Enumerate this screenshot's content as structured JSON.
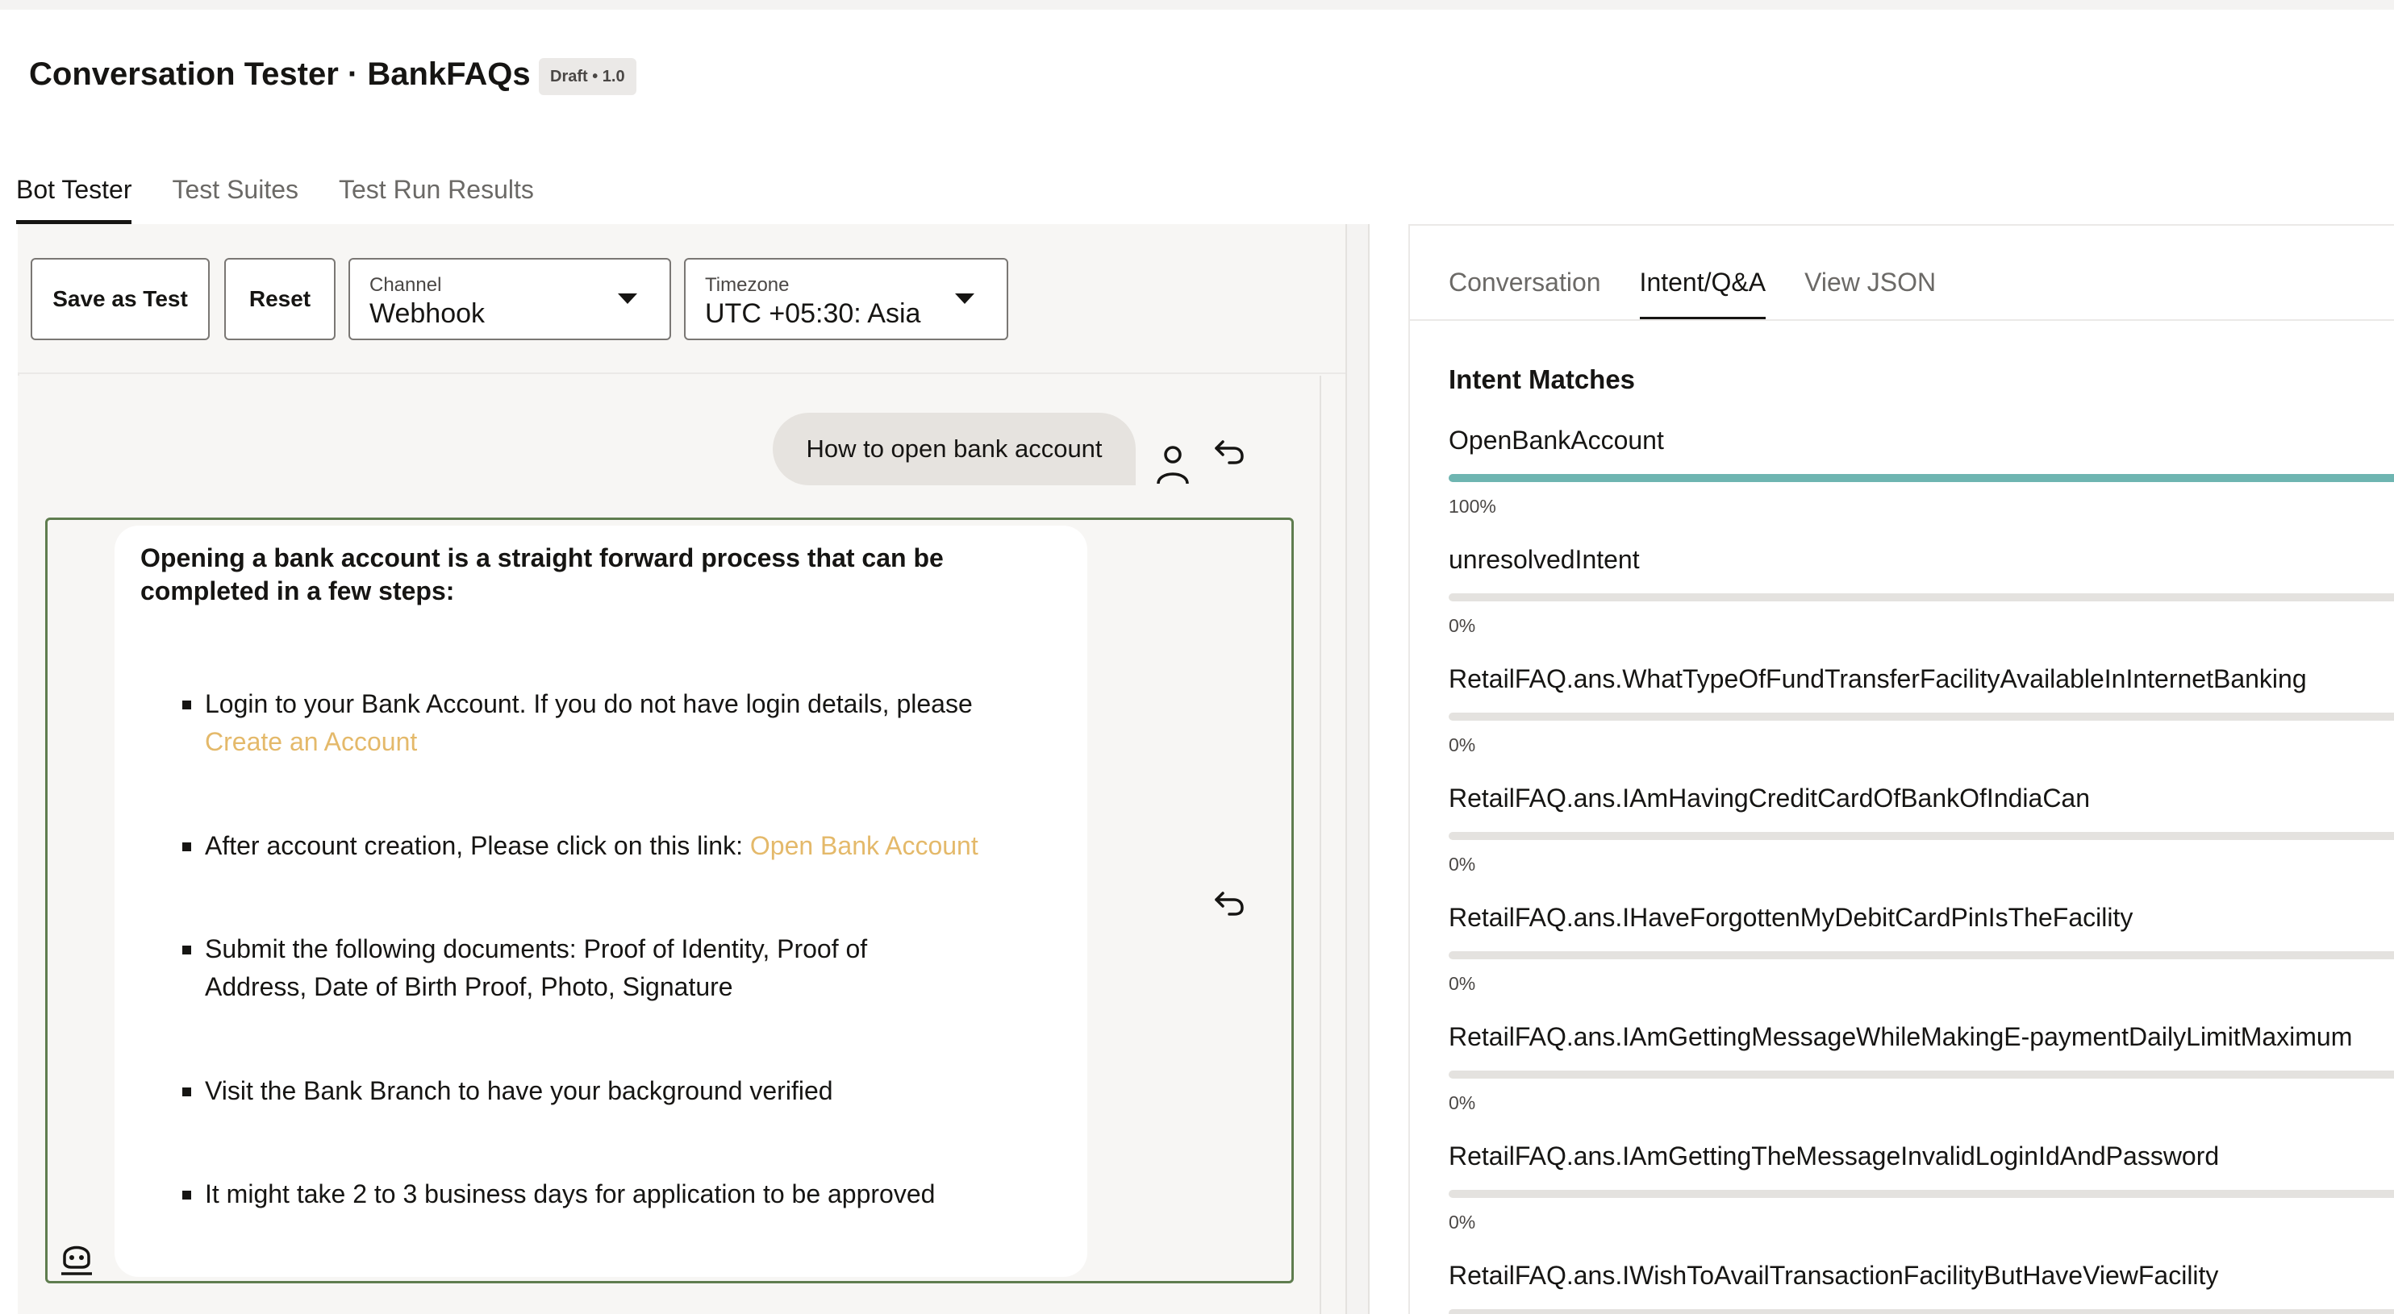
{
  "header": {
    "title": "Conversation Tester · BankFAQs",
    "badge": "Draft • 1.0"
  },
  "main_tabs": [
    {
      "label": "Bot Tester",
      "active": true
    },
    {
      "label": "Test Suites",
      "active": false
    },
    {
      "label": "Test Run Results",
      "active": false
    }
  ],
  "toolbar": {
    "save_label": "Save as Test",
    "reset_label": "Reset",
    "channel": {
      "label": "Channel",
      "value": "Webhook"
    },
    "timezone": {
      "label": "Timezone",
      "value": "UTC +05:30: Asia"
    }
  },
  "conversation": {
    "user_message": "How to open bank account",
    "bot_heading": "Opening a bank account is a straight forward process that can be completed in a few steps:",
    "bot_items": [
      {
        "text": "Login to your Bank Account. If you do not have login details, please",
        "link": "Create an Account"
      },
      {
        "text": "After account creation, Please click on this link: ",
        "link": "Open Bank Account"
      },
      {
        "text": "Submit the following documents: Proof of Identity, Proof of Address, Date of Birth Proof, Photo, Signature",
        "link": ""
      },
      {
        "text": "Visit the Bank Branch to have your background verified",
        "link": ""
      },
      {
        "text": "It might take 2 to 3 business days for application to be approved",
        "link": ""
      }
    ]
  },
  "right_tabs": [
    {
      "label": "Conversation",
      "active": false
    },
    {
      "label": "Intent/Q&A",
      "active": true
    },
    {
      "label": "View JSON",
      "active": false
    }
  ],
  "intents": {
    "title": "Intent Matches",
    "items": [
      {
        "name": "OpenBankAccount",
        "percent": "100%",
        "value": 100
      },
      {
        "name": "unresolvedIntent",
        "percent": "0%",
        "value": 0
      },
      {
        "name": "RetailFAQ.ans.WhatTypeOfFundTransferFacilityAvailableInInternetBanking",
        "percent": "0%",
        "value": 0
      },
      {
        "name": "RetailFAQ.ans.IAmHavingCreditCardOfBankOfIndiaCan",
        "percent": "0%",
        "value": 0
      },
      {
        "name": "RetailFAQ.ans.IHaveForgottenMyDebitCardPinIsTheFacility",
        "percent": "0%",
        "value": 0
      },
      {
        "name": "RetailFAQ.ans.IAmGettingMessageWhileMakingE-paymentDailyLimitMaximum",
        "percent": "0%",
        "value": 0
      },
      {
        "name": "RetailFAQ.ans.IAmGettingTheMessageInvalidLoginIdAndPassword",
        "percent": "0%",
        "value": 0
      },
      {
        "name": "RetailFAQ.ans.IWishToAvailTransactionFacilityButHaveViewFacility",
        "percent": "",
        "value": 0
      }
    ]
  },
  "colors": {
    "accent_bar": "#6eb5b1",
    "link": "#e4b96a",
    "bot_frame": "#5f7d4f"
  },
  "icons": {
    "user": "person-icon",
    "bot": "bot-avatar-icon",
    "replay": "replay-arrow-icon"
  }
}
